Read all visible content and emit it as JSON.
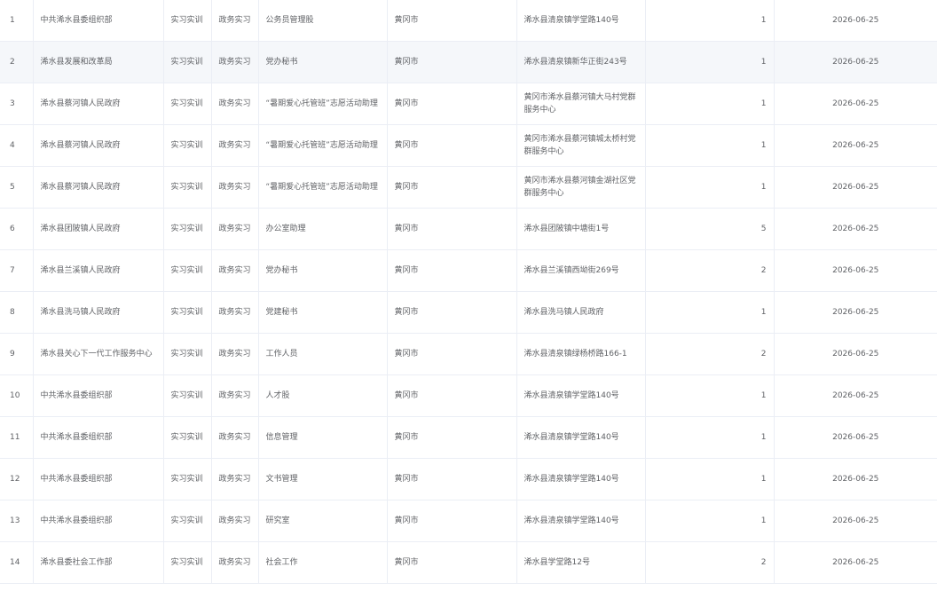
{
  "table": {
    "rows": [
      {
        "index": "1",
        "org": "中共浠水县委组织部",
        "category": "实习实训",
        "type": "政务实习",
        "position": "公务员管理股",
        "city": "黄冈市",
        "address": "浠水县清泉镇学堂路140号",
        "count": "1",
        "deadline": "2026-06-25"
      },
      {
        "index": "2",
        "org": "浠水县发展和改革局",
        "category": "实习实训",
        "type": "政务实习",
        "position": "党办秘书",
        "city": "黄冈市",
        "address": "浠水县清泉镇新华正街243号",
        "count": "1",
        "deadline": "2026-06-25"
      },
      {
        "index": "3",
        "org": "浠水县蔡河镇人民政府",
        "category": "实习实训",
        "type": "政务实习",
        "position": "“暑期爱心托管班”志愿活动助理",
        "city": "黄冈市",
        "address": "黄冈市浠水县蔡河镇大马村党群服务中心",
        "count": "1",
        "deadline": "2026-06-25"
      },
      {
        "index": "4",
        "org": "浠水县蔡河镇人民政府",
        "category": "实习实训",
        "type": "政务实习",
        "position": "“暑期爱心托管班”志愿活动助理",
        "city": "黄冈市",
        "address": "黄冈市浠水县蔡河镇城太桥村党群服务中心",
        "count": "1",
        "deadline": "2026-06-25"
      },
      {
        "index": "5",
        "org": "浠水县蔡河镇人民政府",
        "category": "实习实训",
        "type": "政务实习",
        "position": "“暑期爱心托管班”志愿活动助理",
        "city": "黄冈市",
        "address": "黄冈市浠水县蔡河镇金湖社区党群服务中心",
        "count": "1",
        "deadline": "2026-06-25"
      },
      {
        "index": "6",
        "org": "浠水县团陂镇人民政府",
        "category": "实习实训",
        "type": "政务实习",
        "position": "办公室助理",
        "city": "黄冈市",
        "address": "浠水县团陂镇中塘街1号",
        "count": "5",
        "deadline": "2026-06-25"
      },
      {
        "index": "7",
        "org": "浠水县兰溪镇人民政府",
        "category": "实习实训",
        "type": "政务实习",
        "position": "党办秘书",
        "city": "黄冈市",
        "address": "浠水县兰溪镇西坳街269号",
        "count": "2",
        "deadline": "2026-06-25"
      },
      {
        "index": "8",
        "org": "浠水县洗马镇人民政府",
        "category": "实习实训",
        "type": "政务实习",
        "position": "党建秘书",
        "city": "黄冈市",
        "address": "浠水县洗马镇人民政府",
        "count": "1",
        "deadline": "2026-06-25"
      },
      {
        "index": "9",
        "org": "浠水县关心下一代工作服务中心",
        "category": "实习实训",
        "type": "政务实习",
        "position": "工作人员",
        "city": "黄冈市",
        "address": "浠水县清泉镇绿杨桥路166-1",
        "count": "2",
        "deadline": "2026-06-25"
      },
      {
        "index": "10",
        "org": "中共浠水县委组织部",
        "category": "实习实训",
        "type": "政务实习",
        "position": "人才股",
        "city": "黄冈市",
        "address": "浠水县清泉镇学堂路140号",
        "count": "1",
        "deadline": "2026-06-25"
      },
      {
        "index": "11",
        "org": "中共浠水县委组织部",
        "category": "实习实训",
        "type": "政务实习",
        "position": "信息管理",
        "city": "黄冈市",
        "address": "浠水县清泉镇学堂路140号",
        "count": "1",
        "deadline": "2026-06-25"
      },
      {
        "index": "12",
        "org": "中共浠水县委组织部",
        "category": "实习实训",
        "type": "政务实习",
        "position": "文书管理",
        "city": "黄冈市",
        "address": "浠水县清泉镇学堂路140号",
        "count": "1",
        "deadline": "2026-06-25"
      },
      {
        "index": "13",
        "org": "中共浠水县委组织部",
        "category": "实习实训",
        "type": "政务实习",
        "position": "研究室",
        "city": "黄冈市",
        "address": "浠水县清泉镇学堂路140号",
        "count": "1",
        "deadline": "2026-06-25"
      },
      {
        "index": "14",
        "org": "浠水县委社会工作部",
        "category": "实习实训",
        "type": "政务实习",
        "position": "社会工作",
        "city": "黄冈市",
        "address": "浠水县学堂路12号",
        "count": "2",
        "deadline": "2026-06-25"
      }
    ]
  },
  "colors": {
    "text": "#606266",
    "border": "#ebeef5",
    "hover_row": "#f5f7fa"
  }
}
